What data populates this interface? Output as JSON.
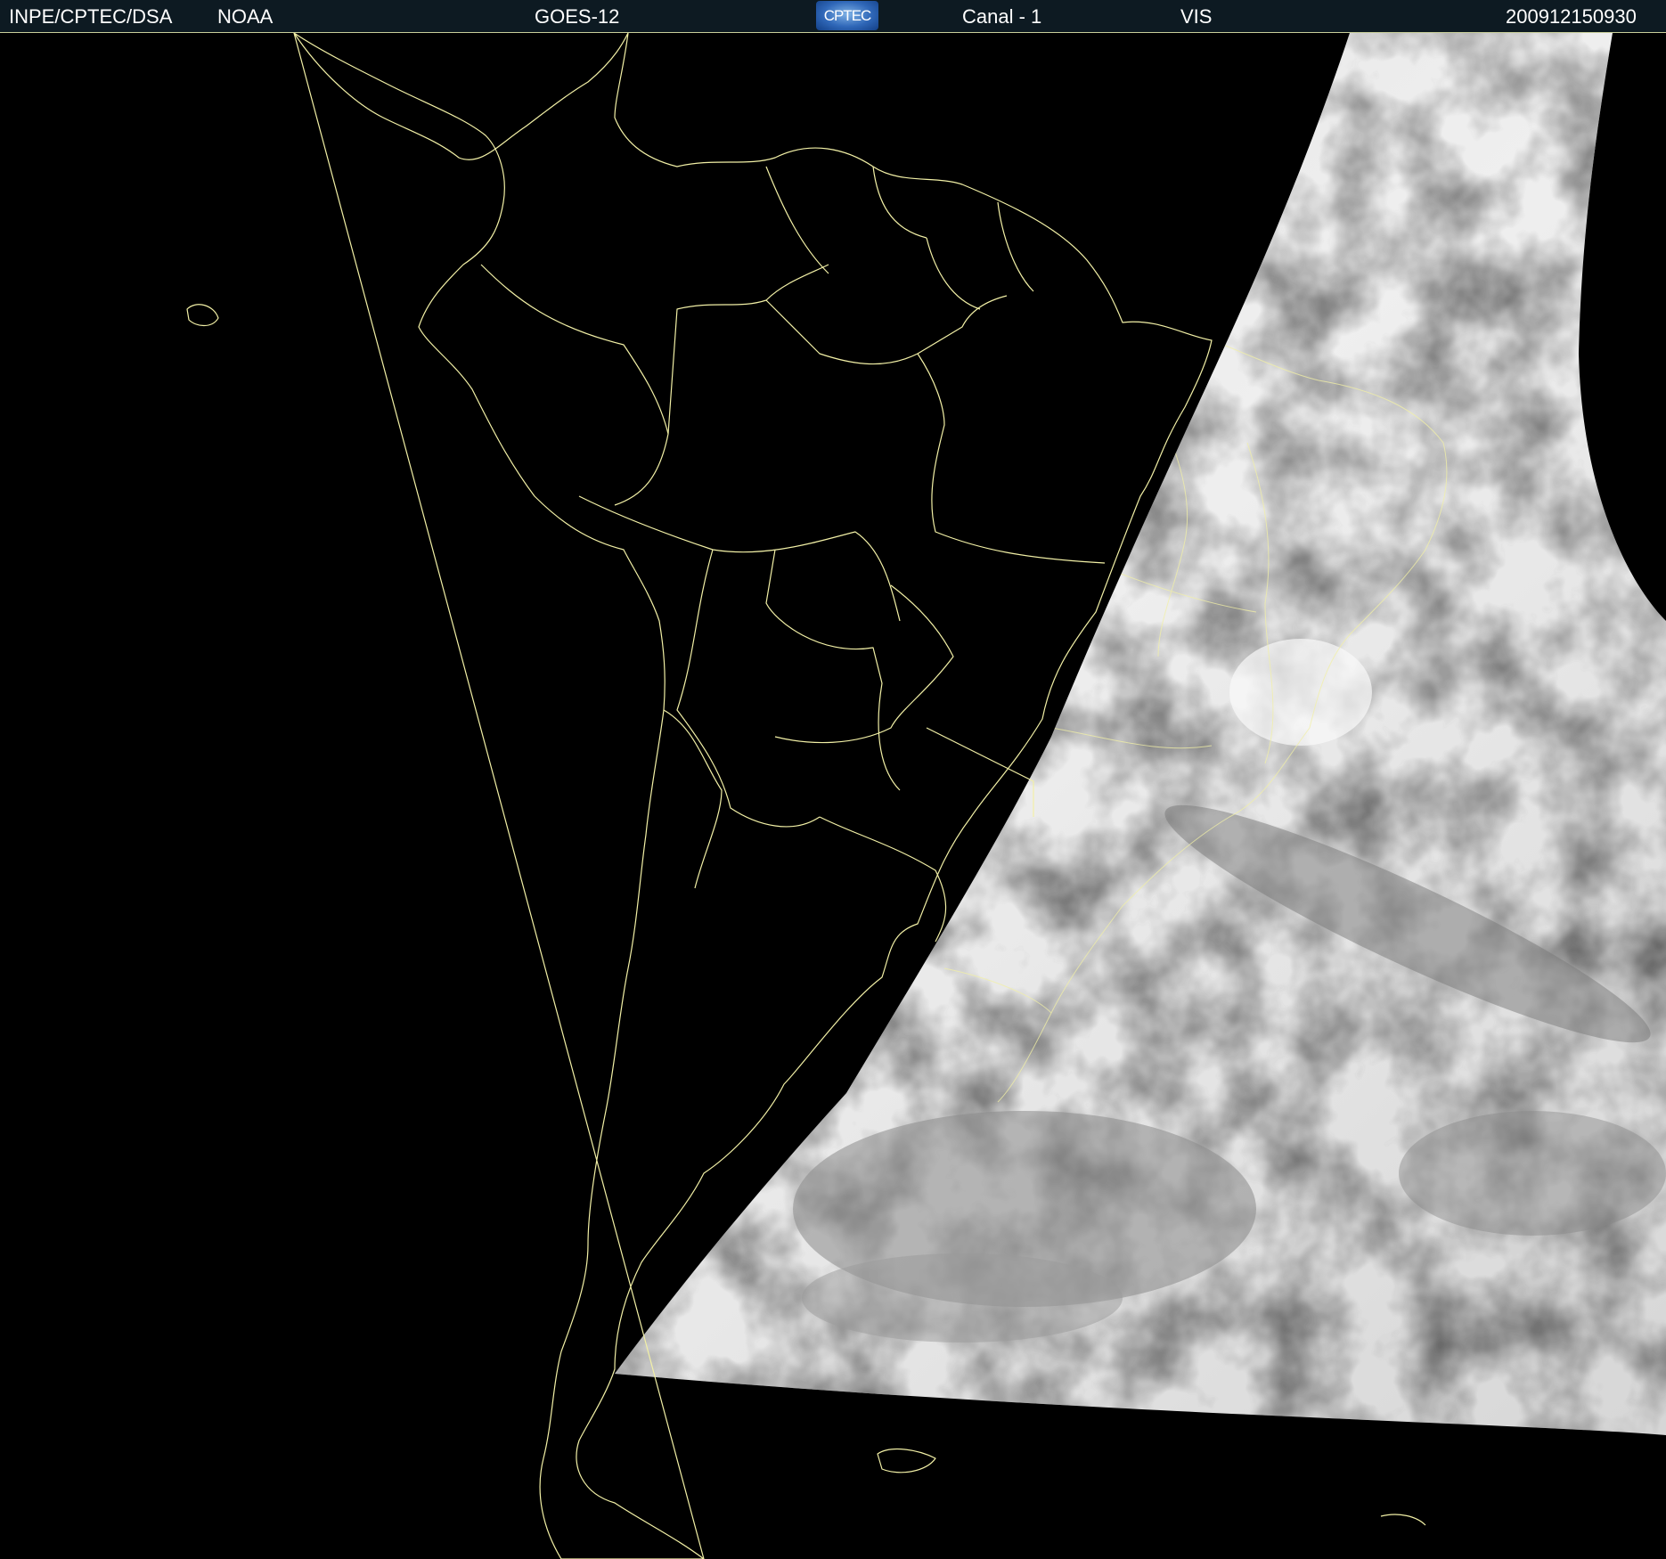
{
  "header": {
    "institution": "INPE/CPTEC/DSA",
    "agency": "NOAA",
    "satellite": "GOES-12",
    "logo_text": "CPTEC",
    "channel": "Canal - 1",
    "band": "VIS",
    "timestamp": "200912150930"
  },
  "colors": {
    "background": "#000000",
    "header_bg": "#0d1a22",
    "borders": "#f2f0a6",
    "clouds_light": "#ececec",
    "clouds_dark": "#6a6a6a"
  },
  "map": {
    "region": "South America",
    "projection": "satellite full disk",
    "layers": [
      "political-borders",
      "coastlines",
      "visible-cloud-imagery"
    ],
    "night_side": "west",
    "day_side": "east"
  }
}
